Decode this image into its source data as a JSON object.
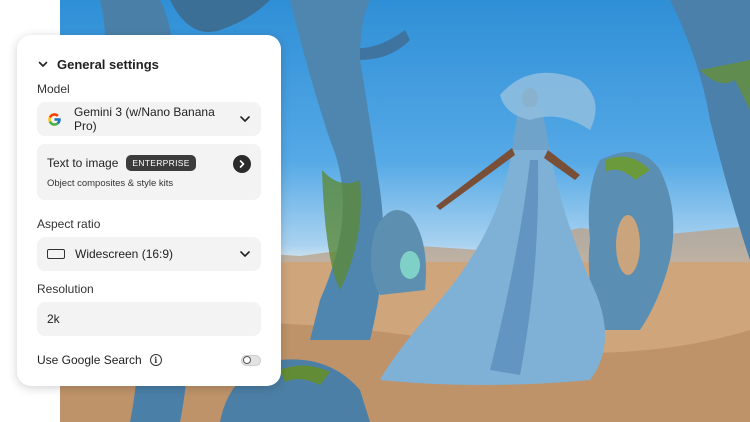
{
  "panel": {
    "section_title": "General settings",
    "model": {
      "label": "Model",
      "value": "Gemini 3 (w/Nano Banana Pro)",
      "provider_icon": "google-g-icon"
    },
    "mode": {
      "title": "Text to image",
      "badge": "ENTERPRISE",
      "subtitle": "Object composites & style kits"
    },
    "aspect_ratio": {
      "label": "Aspect ratio",
      "value": "Widescreen (16:9)"
    },
    "resolution": {
      "label": "Resolution",
      "value": "2k"
    },
    "google_search": {
      "label": "Use Google Search",
      "enabled": false
    }
  },
  "colors": {
    "panel_bg": "#ffffff",
    "field_bg": "#f3f3f3",
    "badge_bg": "#3c3c3c",
    "sky": "#2f8fd6",
    "sand": "#caa078"
  }
}
